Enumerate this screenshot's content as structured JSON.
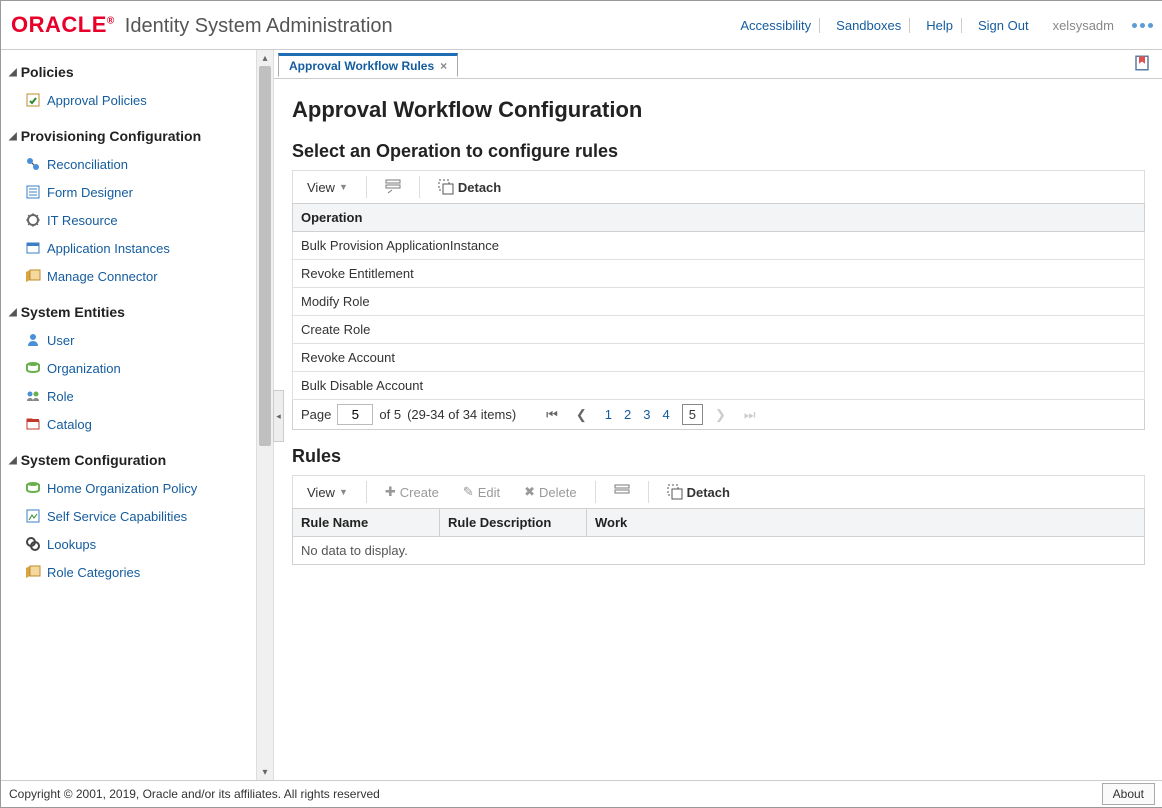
{
  "header": {
    "brand": "ORACLE",
    "app_title": "Identity System Administration",
    "links": {
      "accessibility": "Accessibility",
      "sandboxes": "Sandboxes",
      "help": "Help",
      "sign_out": "Sign Out"
    },
    "user": "xelsysadm"
  },
  "sidebar": {
    "sections": [
      {
        "title": "Policies",
        "items": [
          {
            "label": "Approval Policies"
          }
        ]
      },
      {
        "title": "Provisioning Configuration",
        "items": [
          {
            "label": "Reconciliation"
          },
          {
            "label": "Form Designer"
          },
          {
            "label": "IT Resource"
          },
          {
            "label": "Application Instances"
          },
          {
            "label": "Manage Connector"
          }
        ]
      },
      {
        "title": "System Entities",
        "items": [
          {
            "label": "User"
          },
          {
            "label": "Organization"
          },
          {
            "label": "Role"
          },
          {
            "label": "Catalog"
          }
        ]
      },
      {
        "title": "System Configuration",
        "items": [
          {
            "label": "Home Organization Policy"
          },
          {
            "label": "Self Service Capabilities"
          },
          {
            "label": "Lookups"
          },
          {
            "label": "Role Categories"
          }
        ]
      }
    ]
  },
  "tab": {
    "label": "Approval Workflow Rules"
  },
  "page": {
    "title": "Approval Workflow Configuration",
    "section1_title": "Select an Operation to configure rules",
    "section2_title": "Rules"
  },
  "ops_toolbar": {
    "view": "View",
    "detach": "Detach"
  },
  "ops_table": {
    "header": "Operation",
    "rows": [
      "Bulk Provision ApplicationInstance",
      "Revoke Entitlement",
      "Modify Role",
      "Create Role",
      "Revoke Account",
      "Bulk Disable Account"
    ]
  },
  "pager": {
    "page_label": "Page",
    "page_value": "5",
    "of_text": "of 5",
    "range_text": "(29-34 of 34 items)",
    "pages": [
      "1",
      "2",
      "3",
      "4"
    ],
    "current": "5"
  },
  "rules_toolbar": {
    "view": "View",
    "create": "Create",
    "edit": "Edit",
    "delete": "Delete",
    "detach": "Detach"
  },
  "rules_table": {
    "col1": "Rule Name",
    "col2": "Rule Description",
    "col3": "Work",
    "nodata": "No data to display."
  },
  "footer": {
    "copyright": "Copyright © 2001, 2019, Oracle and/or its affiliates. All rights reserved",
    "about": "About"
  }
}
